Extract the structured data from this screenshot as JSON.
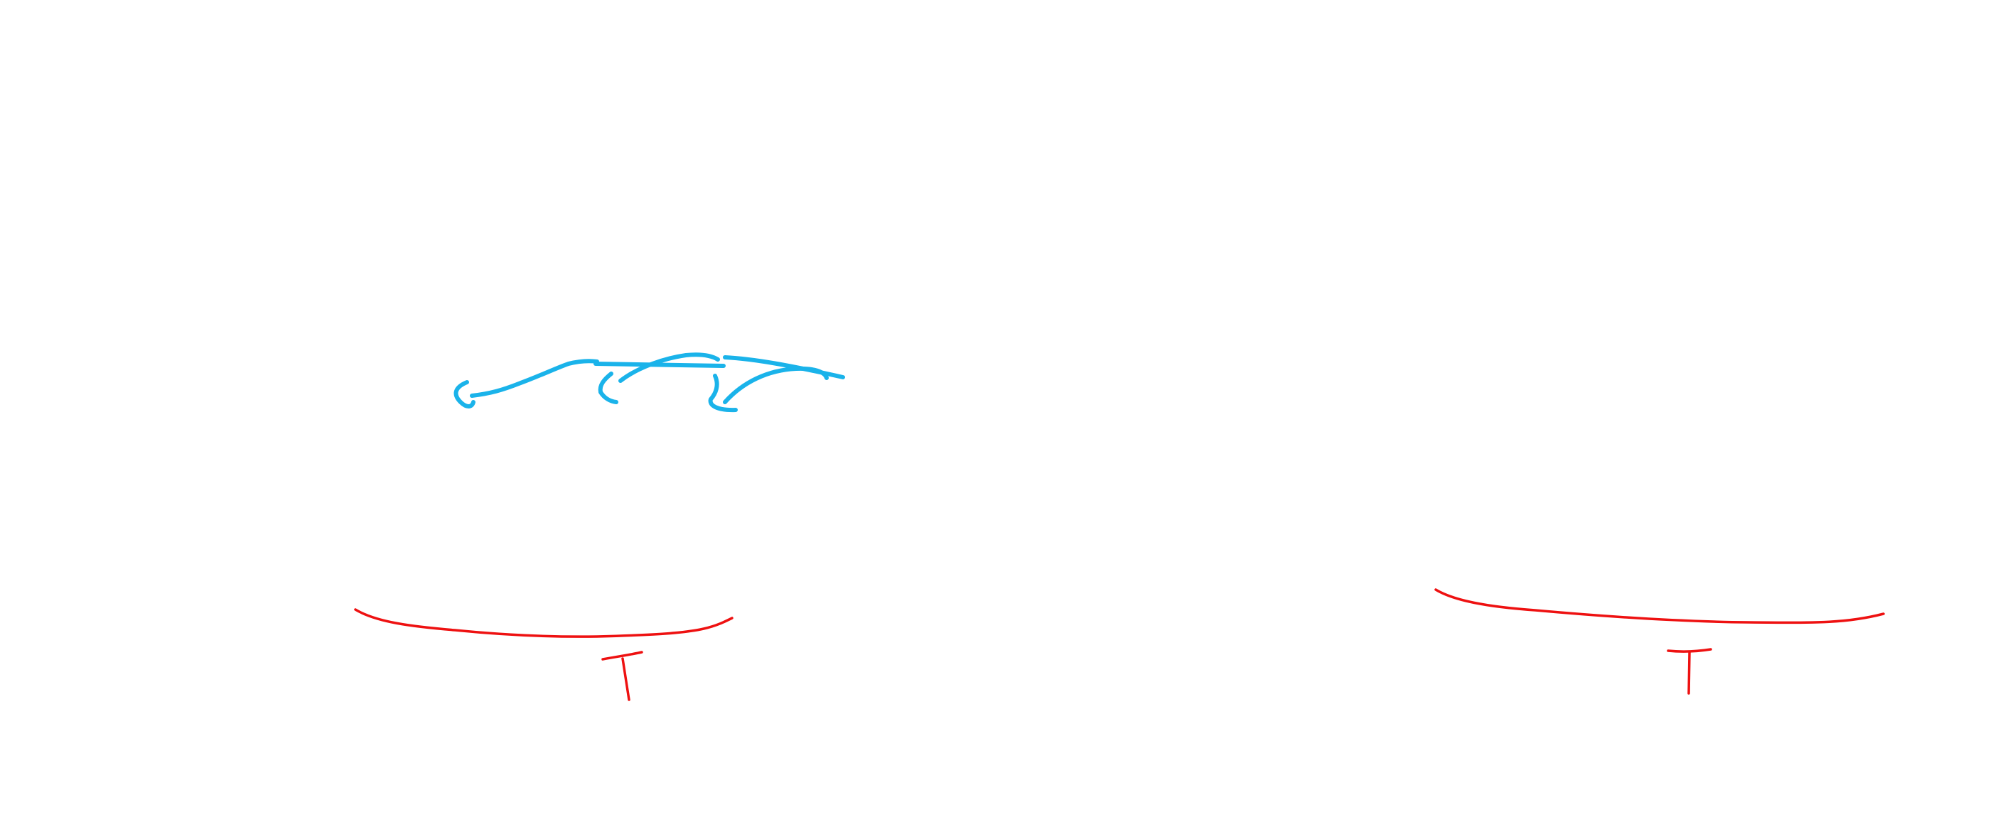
{
  "canvas": {
    "background": "#ffffff"
  },
  "strokes": {
    "blue_color": "#1ab3ea",
    "red_color": "#ee1111"
  }
}
